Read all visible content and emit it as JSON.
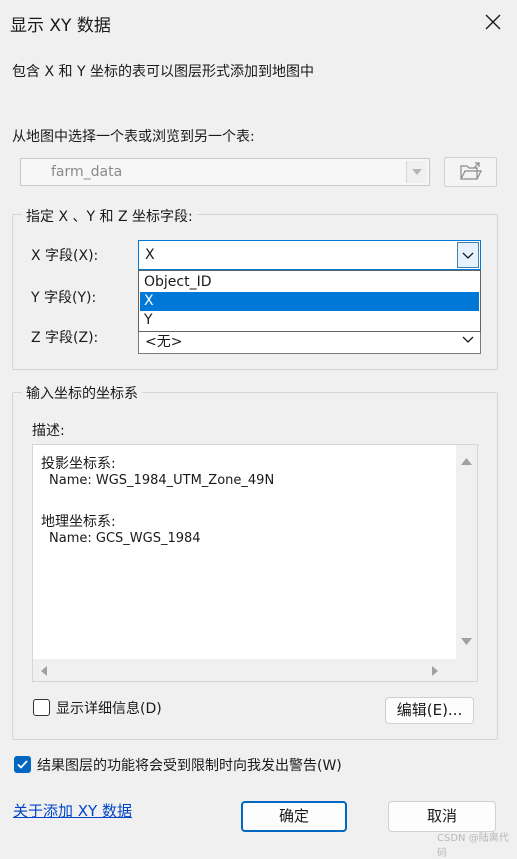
{
  "window": {
    "title": "显示 XY 数据",
    "close_icon": "close-icon"
  },
  "description": "包含 X 和 Y 坐标的表可以图层形式添加到地图中",
  "table_select": {
    "label": "从地图中选择一个表或浏览到另一个表:",
    "value": "farm_data",
    "browse_icon": "folder-open-icon"
  },
  "fields_group": {
    "legend": "指定 X 、Y 和 Z 坐标字段:",
    "x_label": "X 字段(X):",
    "x_value": "X",
    "y_label": "Y 字段(Y):",
    "z_label": "Z 字段(Z):",
    "z_value": "<无>",
    "dropdown_options": [
      "Object_ID",
      "X",
      "Y"
    ],
    "selected_option": "X"
  },
  "coord_group": {
    "legend": "输入坐标的坐标系",
    "desc_label": "描述:",
    "projected_label": "投影坐标系:",
    "projected_name": "Name: WGS_1984_UTM_Zone_49N",
    "geographic_label": "地理坐标系:",
    "geographic_name": "Name: GCS_WGS_1984",
    "show_details_label": "显示详细信息(D)",
    "show_details_checked": false,
    "edit_button": "编辑(E)..."
  },
  "warn_checkbox": {
    "label": "结果图层的功能将会受到限制时向我发出警告(W)",
    "checked": true
  },
  "about_link": "关于添加 XY 数据",
  "ok_button": "确定",
  "cancel_button": "取消",
  "watermark": "CSDN @陆离代码",
  "colors": {
    "accent": "#0067c0",
    "selection": "#0078d7",
    "link": "#0045c8"
  }
}
